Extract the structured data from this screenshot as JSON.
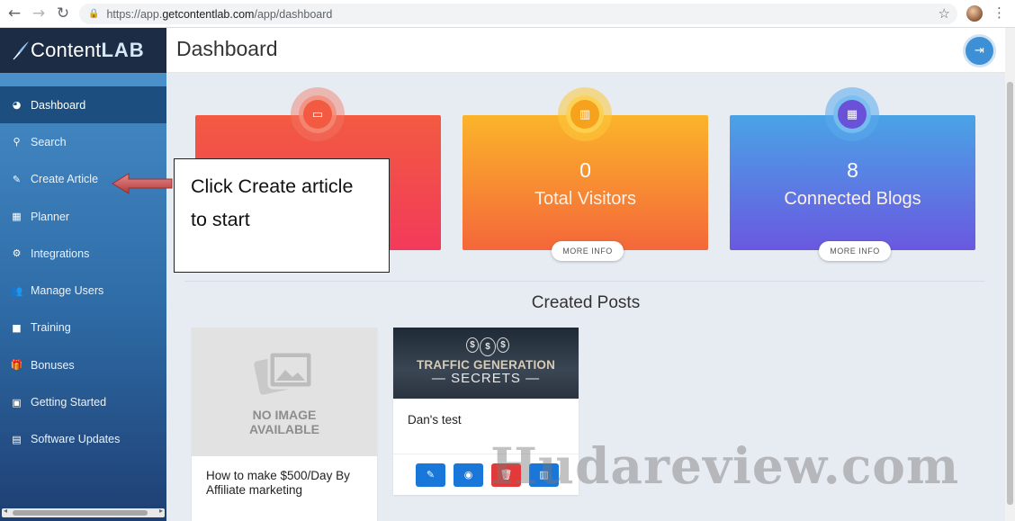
{
  "browser": {
    "url_prefix": "https://app.",
    "url_domain": "getcontentlab.com",
    "url_path": "/app/dashboard"
  },
  "brand": {
    "name_part1": "Content",
    "name_part2": "LAB"
  },
  "sidebar": {
    "items": [
      {
        "label": "Dashboard",
        "icon": "dashboard-icon",
        "active": true
      },
      {
        "label": "Search",
        "icon": "search-icon"
      },
      {
        "label": "Create Article",
        "icon": "edit-icon"
      },
      {
        "label": "Planner",
        "icon": "calendar-icon"
      },
      {
        "label": "Integrations",
        "icon": "cogs-icon"
      },
      {
        "label": "Manage Users",
        "icon": "users-icon"
      },
      {
        "label": "Training",
        "icon": "video-icon"
      },
      {
        "label": "Bonuses",
        "icon": "gift-icon"
      },
      {
        "label": "Getting Started",
        "icon": "book-icon"
      },
      {
        "label": "Software Updates",
        "icon": "clipboard-icon"
      }
    ]
  },
  "header": {
    "title": "Dashboard"
  },
  "stats": [
    {
      "name": "articles",
      "value": "",
      "label": "",
      "more": "",
      "color": "#f25a41"
    },
    {
      "name": "visitors",
      "value": "0",
      "label": "Total Visitors",
      "more": "MORE INFO",
      "color": "#f6a21d"
    },
    {
      "name": "blogs",
      "value": "8",
      "label": "Connected Blogs",
      "more": "MORE INFO",
      "color": "#6a52d8"
    }
  ],
  "callout": {
    "line1": "Click Create article",
    "line2": "to start"
  },
  "posts_section": {
    "title": "Created Posts"
  },
  "posts": [
    {
      "placeholder_line1": "NO IMAGE",
      "placeholder_line2": "AVAILABLE",
      "title": "How to make $500/Day By Affiliate marketing"
    },
    {
      "thumb_line1": "TRAFFIC GENERATION",
      "thumb_line2": "SECRETS",
      "thumb_coin": "$",
      "title": "Dan's test"
    }
  ],
  "watermark": "Hudareview.com"
}
